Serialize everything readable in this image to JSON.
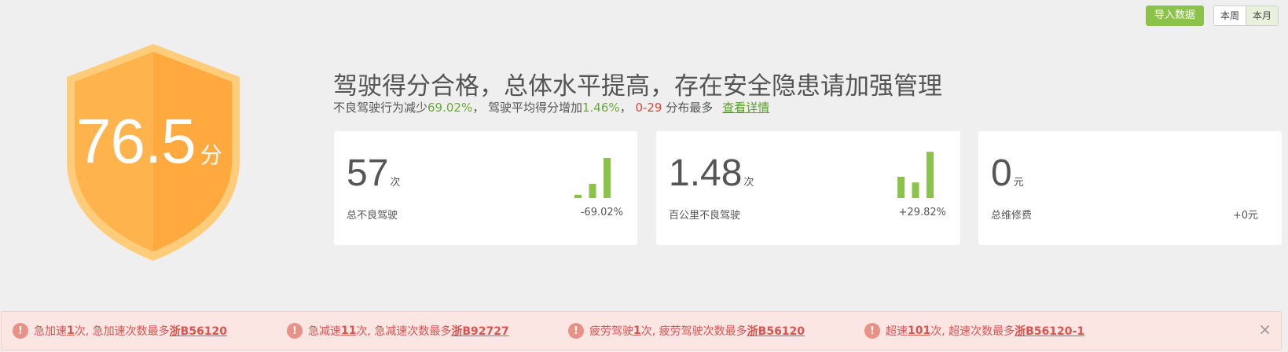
{
  "toolbar": {
    "import_label": "导入数据",
    "period_week": "本周",
    "period_month": "本月",
    "accent_color": "#8bc34a"
  },
  "score": {
    "value": "76.5",
    "unit": "分",
    "shield_color": "#ffab40"
  },
  "summary": {
    "headline": "驾驶得分合格，总体水平提高，存在安全隐患请加强管理",
    "part1": "不良驾驶行为减少",
    "part1_value": "69.02%",
    "part2": "，  驾驶平均得分增加",
    "part2_value": "1.46%",
    "part3": "，  ",
    "range": "0-29",
    "part4": " 分布最多",
    "detail_link": "查看详情"
  },
  "cards": [
    {
      "value": "57",
      "unit": "次",
      "label": "总不良驾驶",
      "change": "-69.02%",
      "bars": [
        0.07,
        0.3,
        0.85
      ]
    },
    {
      "value": "1.48",
      "unit": "次",
      "label": "百公里不良驾驶",
      "change": "+29.82%",
      "bars": [
        0.45,
        0.33,
        0.98
      ]
    },
    {
      "value": "0",
      "unit": "元",
      "label": "总维修费",
      "change": "+0元"
    }
  ],
  "alerts": [
    {
      "a": "急加速",
      "count": "1",
      "b": "次, 急加速次数最多",
      "plate": "浙B56120"
    },
    {
      "a": "急减速",
      "count": "11",
      "b": "次, 急减速次数最多",
      "plate": "浙B92727"
    },
    {
      "a": "疲劳驾驶",
      "count": "1",
      "b": "次, 疲劳驾驶次数最多",
      "plate": "浙B56120"
    },
    {
      "a": "超速",
      "count": "101",
      "b": "次, 超速次数最多",
      "plate": "浙B56120-1"
    }
  ],
  "alert_close": "×",
  "alert_icon": "!"
}
